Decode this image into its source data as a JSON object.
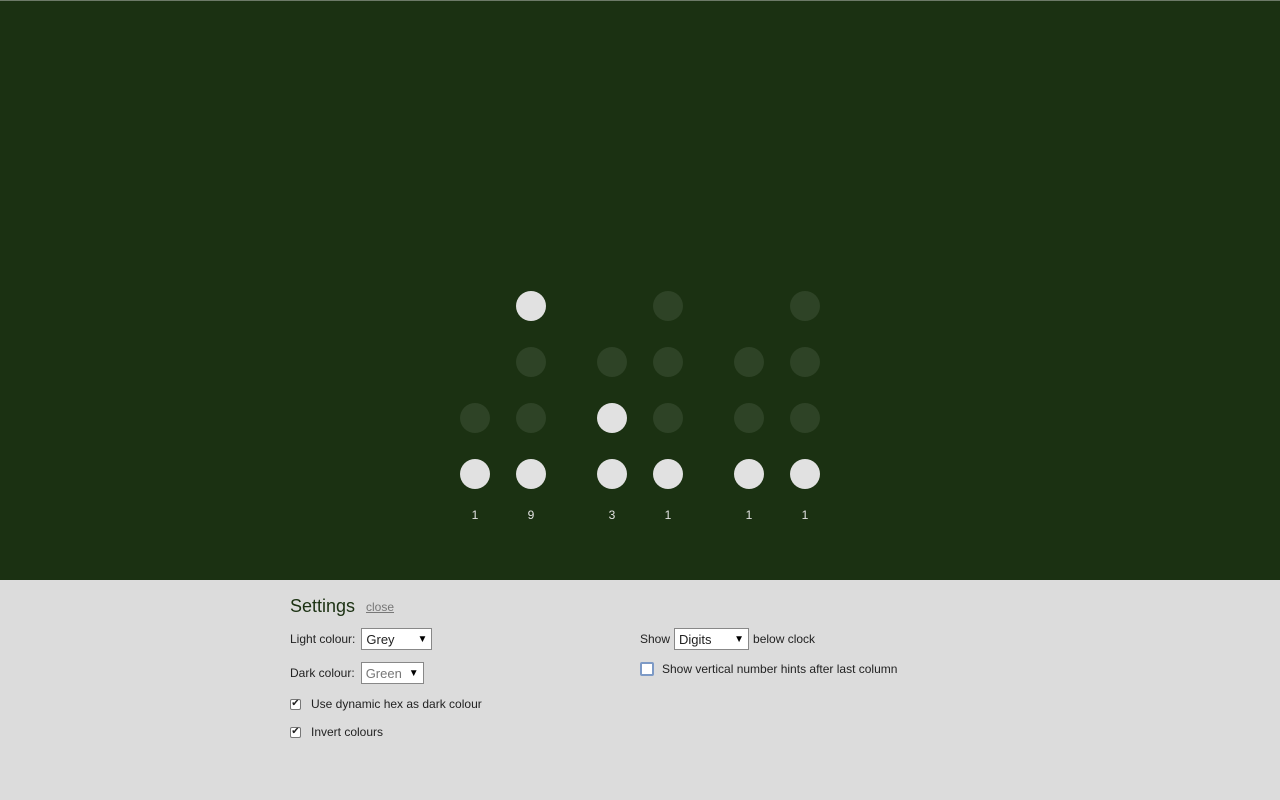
{
  "clock": {
    "columns": [
      {
        "digit": "1",
        "bits": [
          "hidden",
          "hidden",
          "off",
          "on"
        ]
      },
      {
        "digit": "9",
        "bits": [
          "on",
          "off",
          "off",
          "on"
        ]
      },
      {
        "digit": "3",
        "bits": [
          "hidden",
          "off",
          "on",
          "on"
        ]
      },
      {
        "digit": "1",
        "bits": [
          "off",
          "off",
          "off",
          "on"
        ]
      },
      {
        "digit": "1",
        "bits": [
          "hidden",
          "off",
          "off",
          "on"
        ]
      },
      {
        "digit": "1",
        "bits": [
          "off",
          "off",
          "off",
          "on"
        ]
      }
    ],
    "colors": {
      "background": "#1b3112",
      "light": "#e1e1e1",
      "dark": "#2e4326"
    }
  },
  "settings": {
    "title": "Settings",
    "close_label": "close",
    "light_colour": {
      "label": "Light colour:",
      "value": "Grey"
    },
    "dark_colour": {
      "label": "Dark colour:",
      "value": "Green"
    },
    "dynamic_hex": {
      "label": "Use dynamic hex as dark colour",
      "checked": true
    },
    "invert": {
      "label": "Invert colours",
      "checked": true
    },
    "show": {
      "prefix": "Show",
      "value": "Digits",
      "suffix": "below clock"
    },
    "vertical_hints": {
      "label": "Show vertical number hints after last column",
      "checked": false
    }
  }
}
